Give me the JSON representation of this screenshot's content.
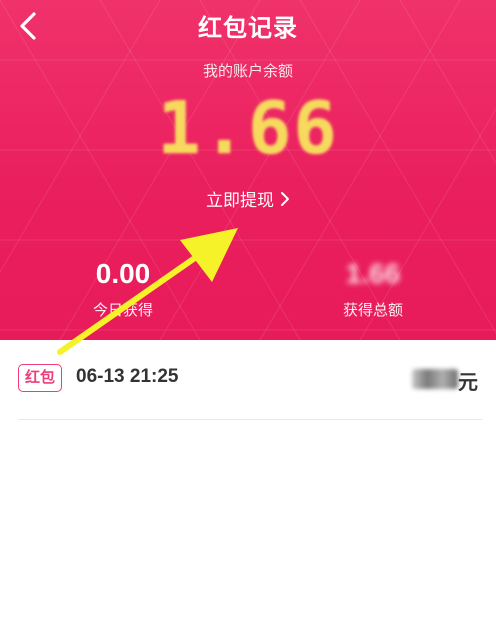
{
  "header": {
    "title": "红包记录",
    "back_icon": "chevron-left-icon"
  },
  "balance": {
    "label": "我的账户余额",
    "amount": "1.66",
    "amount_color": "#f7d95e"
  },
  "withdraw": {
    "label": "立即提现",
    "icon": "chevron-right-icon"
  },
  "stats": {
    "today": {
      "value": "0.00",
      "label": "今日获得"
    },
    "total": {
      "value": "1.66",
      "label": "获得总额"
    }
  },
  "records": [
    {
      "tag": "红包",
      "time": "06-13 21:25",
      "unit": "元"
    }
  ],
  "colors": {
    "header_bg": "#ea1f5e",
    "tag_accent": "#ee3d77",
    "annotation_arrow": "#f5f22a"
  }
}
